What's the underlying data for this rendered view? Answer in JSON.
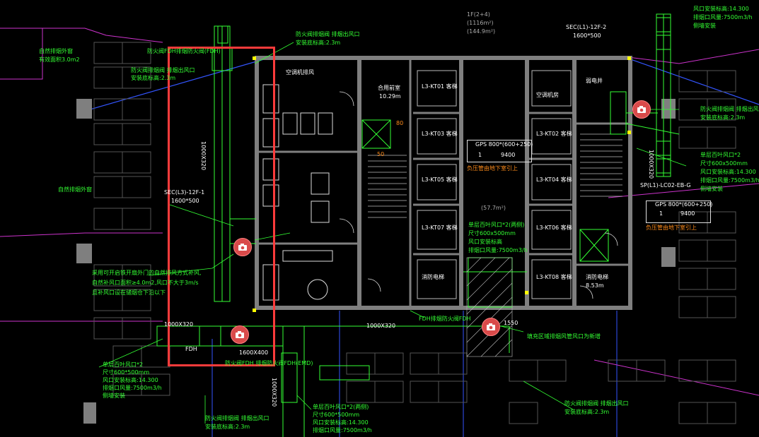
{
  "colors": {
    "background": "#000000",
    "wall": "#7f7f7f",
    "duct_green": "#33ff33",
    "annotation_red": "#ff3b3b",
    "magenta_line": "#cc33cc",
    "blue_line": "#3355ff",
    "camera_marker": "#d94a4a"
  },
  "labels": {
    "left_natural_smoke_outlet": "自然排烟外窗",
    "left_natural_smoke_area": "有效面积3.0m2",
    "fire_damper_top": "防火阀FDH排烟防火阀(FDH)",
    "sec_left": "SEC(L3)-12F-1",
    "sec_left_size": "1600*500",
    "natural_window_mid": "自然排烟外窗",
    "note_left_line1": "采用可开启铁开扇外门的自然排风方式补风,",
    "note_left_line2": "自然补风口面积≥4.0m2,风口不大于3m/s",
    "note_left_line3": "且补风口设在储烟仓下沿以下",
    "duct_vert_left": "1000X320",
    "duct_bottom_left": "1000X320",
    "fdh_bottom_left": "FDH",
    "size_1600x400": "1600X400",
    "fdh_label_bottom": "防火阀FDH 排烟防火阀FDH(EMD)",
    "exhaust_left_title": "单层百叶风口*2",
    "exhaust_left_size": "尺寸600*500mm",
    "exhaust_left_height": "风口安装标高:14.300",
    "exhaust_left_vol": "排烟口风量:7500m3/h",
    "exhaust_left_note": "侧墙安装",
    "smoke_vent_title": "防火阀排烟阀 排烟出风口",
    "smoke_vent_height": "安装底标高:2.3m",
    "smoke_vent_bottom_title": "防火阀排烟阀 排烟出风口",
    "smoke_vent_bottom_height": "安装底标高:2.3m",
    "smoke_vent_bottom2_title": "单层百叶风口*2(两侧)",
    "smoke_vent_bottom2_size": "尺寸600*500mm",
    "smoke_vent_bottom2_height": "风口安装标高:14.300",
    "smoke_vent_bottom2_vol": "排烟口风量:7500m3/h",
    "smoke_vent_bottom2_note": "侧墙安装",
    "top_room": "1F(2+4)",
    "top_room_sub1": "(1116m²)",
    "top_room_sub2": "(144.9m²)",
    "top_fire_title": "防火阀排烟阀 排烟出风口",
    "top_fire_height": "安装底标高:2.3m",
    "sec_right": "SEC(L1)-12F-2",
    "sec_right_size": "1600*500",
    "room_toilet": "空调机排风",
    "room_front": "合用前室",
    "room_front_area": "10.29m",
    "duct_vert_mid": "1000X320",
    "room_lift": "消防电梯",
    "lift_1": "L3-KT01 客梯",
    "lift_2": "L3-KT02 客梯",
    "lift_3": "L3-KT03 客梯",
    "lift_4": "L3-KT04 客梯",
    "lift_5": "L3-KT05 客梯",
    "lift_6": "L3-KT06 客梯",
    "lift_7": "L3-KT07 客梯",
    "lift_8": "L3-KT08 客梯",
    "gps_label": "GPS 800*(600+250)",
    "gps_1": "1",
    "gps_2": "9400",
    "gps_note": "负压管由地下室引上",
    "hall_area": "(57.7m²)",
    "exhaust_mid_title": "单层百叶风口*2(两侧)",
    "exhaust_mid_size": "尺寸600x500mm",
    "exhaust_mid_height": "风口安装标高",
    "exhaust_mid_vol": "排烟口风量:7500m3/h",
    "duct_bottom_mid": "1000X320",
    "fdh_bottom_mid": "FDH排烟防火阀FDH",
    "size_1550": "1550",
    "shaft_note": "填充区域排烟风管风口为新增",
    "room_air_right": "空调机房",
    "room_right_area": "8.53m",
    "room_elec": "弱电井",
    "room_ups": "消防电梯",
    "fire_right_title": "防火阀排烟阀 排烟出风口",
    "fire_right_height": "安装底标高:2.3m",
    "exhaust_right_title": "单层百叶风口*2",
    "exhaust_right_size": "尺寸600x500mm",
    "exhaust_right_height": "风口安装标高:14.300",
    "exhaust_right_vol": "排烟口风量:7500m3/h",
    "exhaust_right_note": "侧墙安装",
    "sp_right": "SP(L1)-LC02-EB-G",
    "gps_right": "GPS 800*(600+250)",
    "gps_right_1": "1",
    "gps_right_2": "9400",
    "gps_right_note": "负压管由地下室引上",
    "duct_vert_right": "1000X320",
    "top_right_size": "风口安装标高:14.300",
    "top_right_vol": "排烟口风量:7500m3/h",
    "top_right_note": "侧墙安装",
    "bottom_right_title": "防火阀排烟阀 排烟出风口",
    "bottom_right_height": "安装底标高:2.3m",
    "dim_80": "80",
    "dim_50": "50"
  },
  "markers": [
    "camera-icon",
    "camera-icon",
    "camera-icon",
    "camera-icon"
  ]
}
